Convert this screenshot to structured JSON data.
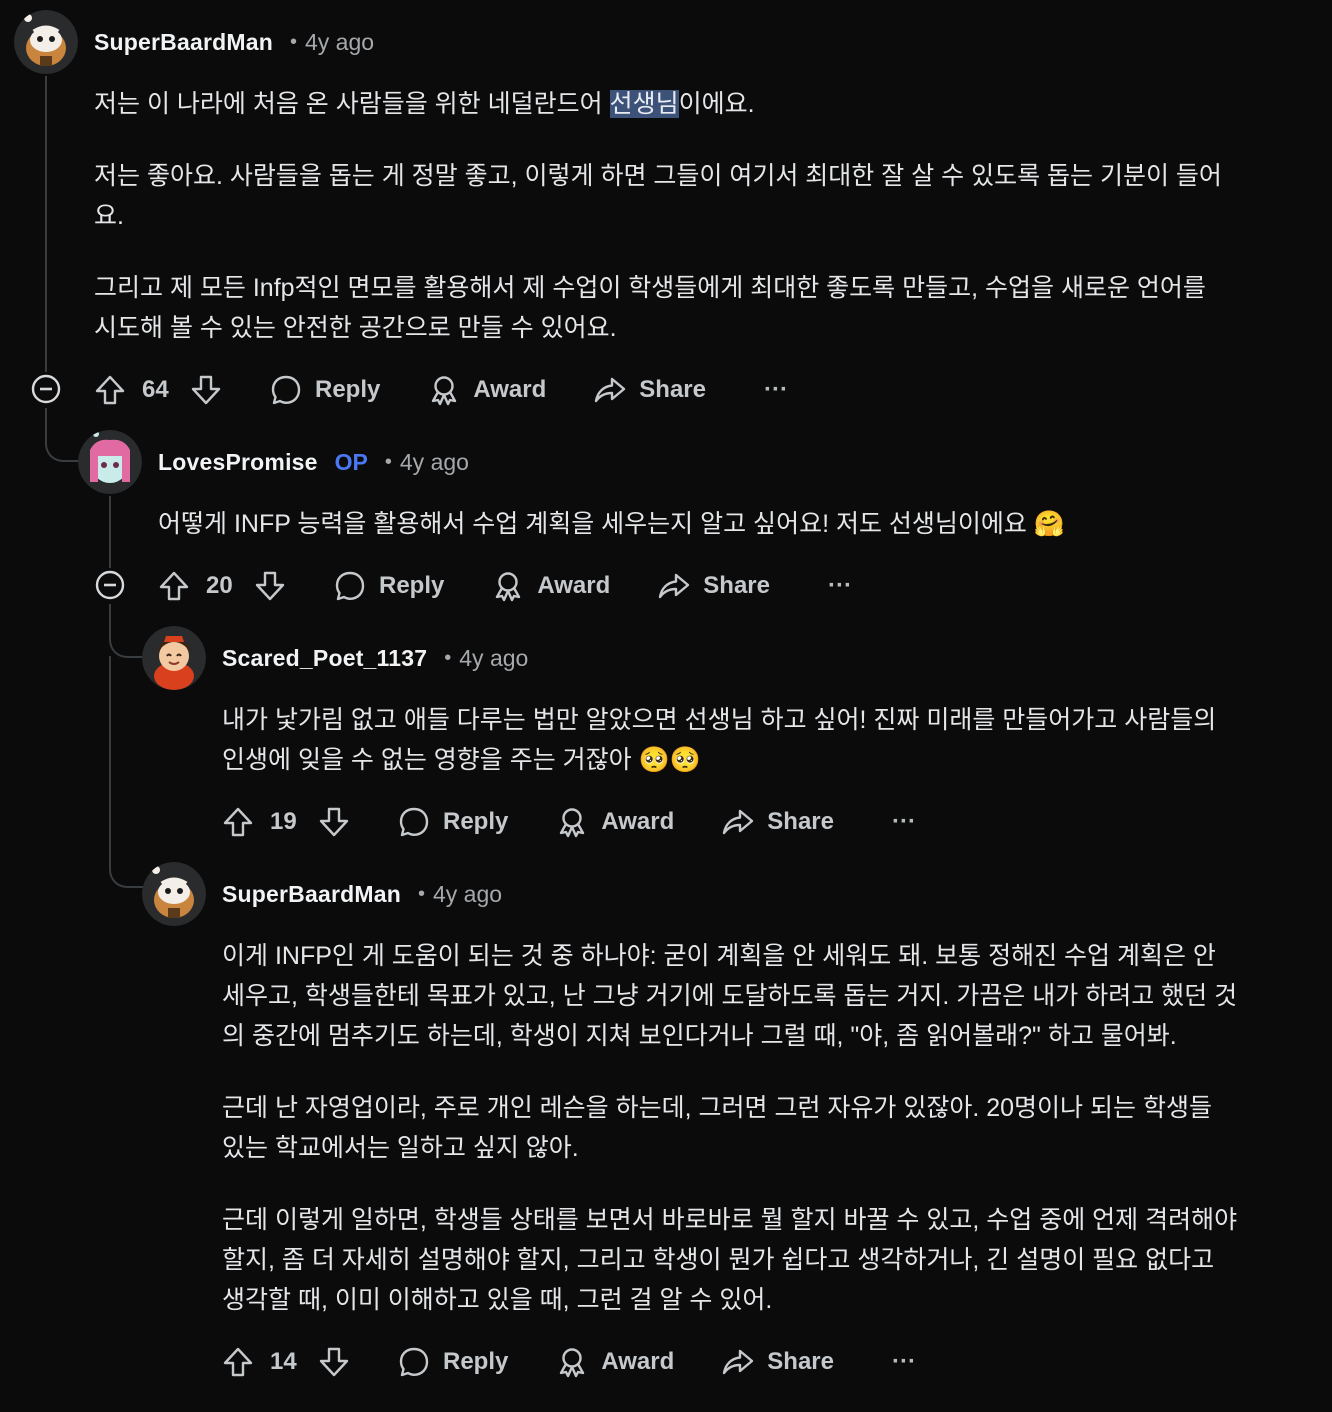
{
  "comments": [
    {
      "username": "SuperBaardMan",
      "op_badge": "",
      "time": "4y ago",
      "paragraph_1_before": "저는 이 나라에 처음 온 사람들을 위한 네덜란드어 ",
      "paragraph_1_highlight": "선생님",
      "paragraph_1_after": "이에요.",
      "paragraph_2_line_1": "저는 좋아요. 사람들을 돕는 게 정말 좋고, 이렇게 하면 그들이 여기서 최대한 잘 살 수 있도록 돕는 기분이 들어",
      "paragraph_2_line_2": "요.",
      "paragraph_3_line_1": "그리고 제 모든 Infp적인 면모를 활용해서 제 수업이 학생들에게 최대한 좋도록 만들고, 수업을 새로운 언어를",
      "paragraph_3_line_2": "시도해 볼 수 있는 안전한 공간으로 만들 수 있어요.",
      "votes": "64",
      "reply": "Reply",
      "award": "Award",
      "share": "Share",
      "more": "···"
    },
    {
      "username": "LovesPromise",
      "op_badge": "OP",
      "time": "4y ago",
      "line_1": "어떻게 INFP 능력을 활용해서 수업 계획을 세우는지 알고 싶어요! 저도 선생님이에요 🤗",
      "votes": "20",
      "reply": "Reply",
      "award": "Award",
      "share": "Share",
      "more": "···"
    },
    {
      "username": "Scared_Poet_1137",
      "time": "4y ago",
      "line_1": "내가 낯가림 없고 애들 다루는 법만 알았으면 선생님 하고 싶어! 진짜 미래를 만들어가고 사람들의",
      "line_2": "인생에 잊을 수 없는 영향을 주는 거잖아 🥺🥺",
      "votes": "19",
      "reply": "Reply",
      "award": "Award",
      "share": "Share",
      "more": "···"
    },
    {
      "username": "SuperBaardMan",
      "time": "4y ago",
      "paragraph_1_line_1": "이게 INFP인 게 도움이 되는 것 중 하나야: 굳이 계획을 안 세워도 돼. 보통 정해진 수업 계획은 안",
      "paragraph_1_line_2": "세우고, 학생들한테 목표가 있고, 난 그냥 거기에 도달하도록 돕는 거지. 가끔은 내가 하려고 했던 것",
      "paragraph_1_line_3": "의 중간에 멈추기도 하는데, 학생이 지쳐 보인다거나 그럴 때, \"야, 좀 읽어볼래?\" 하고 물어봐.",
      "paragraph_2_line_1": "근데 난 자영업이라, 주로 개인 레슨을 하는데, 그러면 그런 자유가 있잖아. 20명이나 되는 학생들",
      "paragraph_2_line_2": "있는 학교에서는 일하고 싶지 않아.",
      "paragraph_3_line_1": "근데 이렇게 일하면, 학생들 상태를 보면서 바로바로 뭘 할지 바꿀 수 있고, 수업 중에 언제 격려해야",
      "paragraph_3_line_2": "할지, 좀 더 자세히 설명해야 할지, 그리고 학생이 뭔가 쉽다고 생각하거나, 긴 설명이 필요 없다고",
      "paragraph_3_line_3": "생각할 때, 이미 이해하고 있을 때, 그런 걸 알 수 있어.",
      "votes": "14",
      "reply": "Reply",
      "award": "Award",
      "share": "Share",
      "more": "···"
    }
  ],
  "icons": {
    "upvote": "arrow-up-icon",
    "downvote": "arrow-down-icon",
    "reply": "speech-bubble-icon",
    "award": "award-ribbon-icon",
    "share": "share-arrow-icon",
    "collapse": "minus-circle-icon"
  },
  "colors": {
    "background": "#0b0b0c",
    "text": "#e4e6e8",
    "muted": "#a6a9ac",
    "op_badge": "#4a78f2",
    "highlight": "#3d5278",
    "thread_line": "#3a3d40"
  }
}
